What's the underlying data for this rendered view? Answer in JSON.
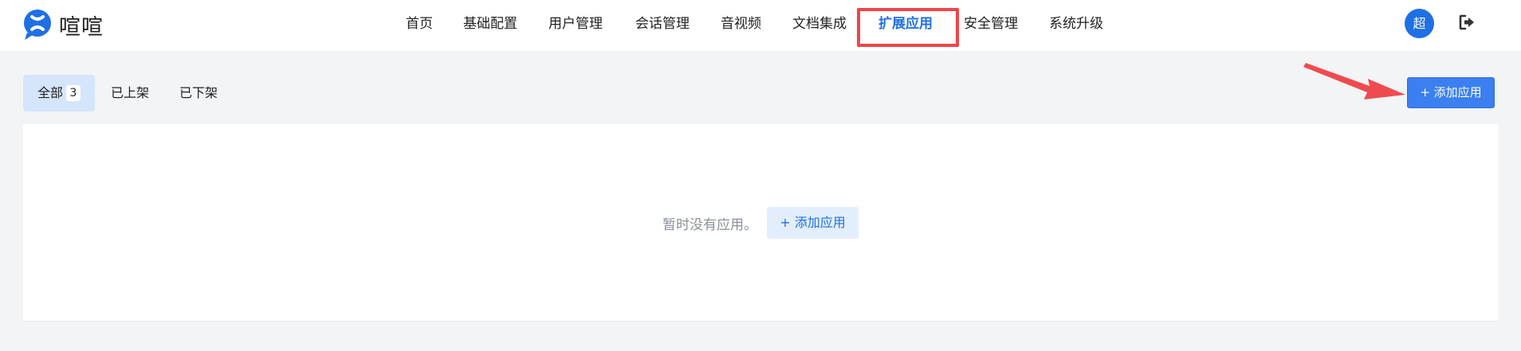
{
  "app": {
    "name": "喧喧",
    "brand_color": "#1f6fe5",
    "logo_icon": "xuanxuan-logo-icon"
  },
  "nav": {
    "items": [
      {
        "label": "首页"
      },
      {
        "label": "基础配置"
      },
      {
        "label": "用户管理"
      },
      {
        "label": "会话管理"
      },
      {
        "label": "音视频"
      },
      {
        "label": "文档集成"
      },
      {
        "label": "扩展应用",
        "active": true
      },
      {
        "label": "安全管理"
      },
      {
        "label": "系统升级"
      }
    ],
    "highlight_color": "#f0454a"
  },
  "user": {
    "avatar_text": "超",
    "logout_icon": "sign-out-icon"
  },
  "filters": {
    "tabs": [
      {
        "label": "全部",
        "count": "3",
        "active": true
      },
      {
        "label": "已上架"
      },
      {
        "label": "已下架"
      }
    ]
  },
  "toolbar": {
    "add_app_label": "+ 添加应用",
    "annotation_arrow_color": "#ef4b4f"
  },
  "main": {
    "empty_text": "暂时没有应用。",
    "empty_add_label": "+ 添加应用"
  }
}
